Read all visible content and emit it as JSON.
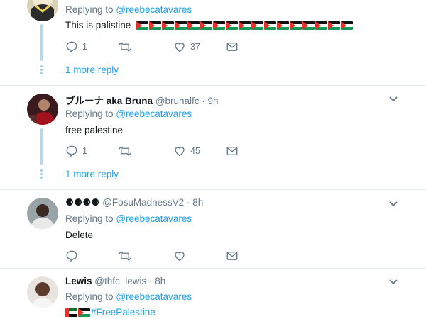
{
  "tweets": [
    {
      "replying_prefix": "Replying to",
      "replying_handle": "@reebecatavares",
      "text": "This is palistine",
      "flag_count": 17,
      "flag_icon": "palestine-flag-icon",
      "reply_count": "1",
      "retweet_count": "",
      "like_count": "37",
      "more_reply": "1 more reply"
    },
    {
      "name": "ブルーナ aka Bruna",
      "handle": "@brunalfc",
      "time": "· 9h",
      "replying_prefix": "Replying to",
      "replying_handle": "@reebecatavares",
      "text": "free palestine",
      "reply_count": "1",
      "retweet_count": "",
      "like_count": "45",
      "more_reply": "1 more reply"
    },
    {
      "name": "⚈⚈⚈⚈",
      "handle": "@FosuMadnessV2",
      "time": "· 8h",
      "replying_prefix": "Replying to",
      "replying_handle": "@reebecatavares",
      "text": "Delete",
      "reply_count": "",
      "retweet_count": "",
      "like_count": ""
    },
    {
      "name": "Lewis",
      "handle": "@thfc_lewis",
      "time": "· 8h",
      "replying_prefix": "Replying to",
      "replying_handle": "@reebecatavares",
      "hashtag": "#FreePalestine",
      "flag_icons": [
        "uae-flag-icon",
        "palestine-flag-icon"
      ]
    }
  ],
  "colors": {
    "link": "#1da1f2",
    "muted": "#657786",
    "thread_line": "#a9dcf5",
    "separator": "#e6ecf0"
  }
}
